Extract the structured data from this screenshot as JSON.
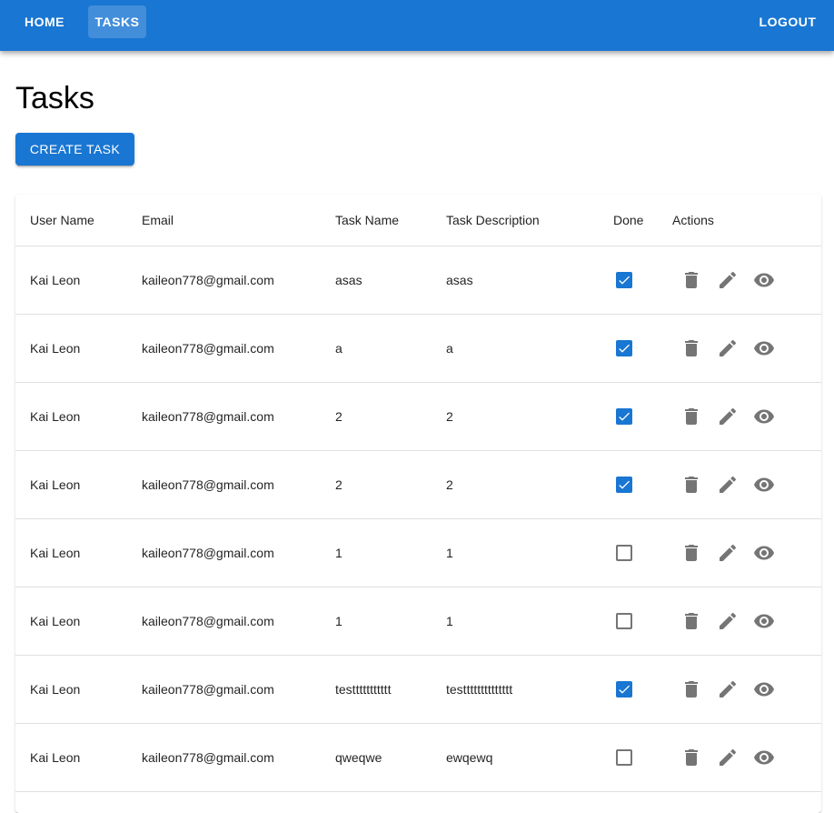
{
  "nav": {
    "home": "HOME",
    "tasks": "TASKS",
    "logout": "LOGOUT"
  },
  "page": {
    "title": "Tasks",
    "create_button": "CREATE TASK"
  },
  "colors": {
    "primary": "#1976d2",
    "icon": "#757575"
  },
  "table": {
    "headers": {
      "user_name": "User Name",
      "email": "Email",
      "task_name": "Task Name",
      "task_description": "Task Description",
      "done": "Done",
      "actions": "Actions"
    },
    "action_icons": [
      "delete-icon",
      "edit-icon",
      "visibility-icon"
    ],
    "rows": [
      {
        "user": "Kai Leon",
        "email": "kaileon778@gmail.com",
        "task": "asas",
        "description": "asas",
        "done": true
      },
      {
        "user": "Kai Leon",
        "email": "kaileon778@gmail.com",
        "task": "a",
        "description": "a",
        "done": true
      },
      {
        "user": "Kai Leon",
        "email": "kaileon778@gmail.com",
        "task": "2",
        "description": "2",
        "done": true
      },
      {
        "user": "Kai Leon",
        "email": "kaileon778@gmail.com",
        "task": "2",
        "description": "2",
        "done": true
      },
      {
        "user": "Kai Leon",
        "email": "kaileon778@gmail.com",
        "task": "1",
        "description": "1",
        "done": false
      },
      {
        "user": "Kai Leon",
        "email": "kaileon778@gmail.com",
        "task": "1",
        "description": "1",
        "done": false
      },
      {
        "user": "Kai Leon",
        "email": "kaileon778@gmail.com",
        "task": "testtttttttttt",
        "description": "testttttttttttttt",
        "done": true
      },
      {
        "user": "Kai Leon",
        "email": "kaileon778@gmail.com",
        "task": "qweqwe",
        "description": "ewqewq",
        "done": false
      }
    ]
  }
}
